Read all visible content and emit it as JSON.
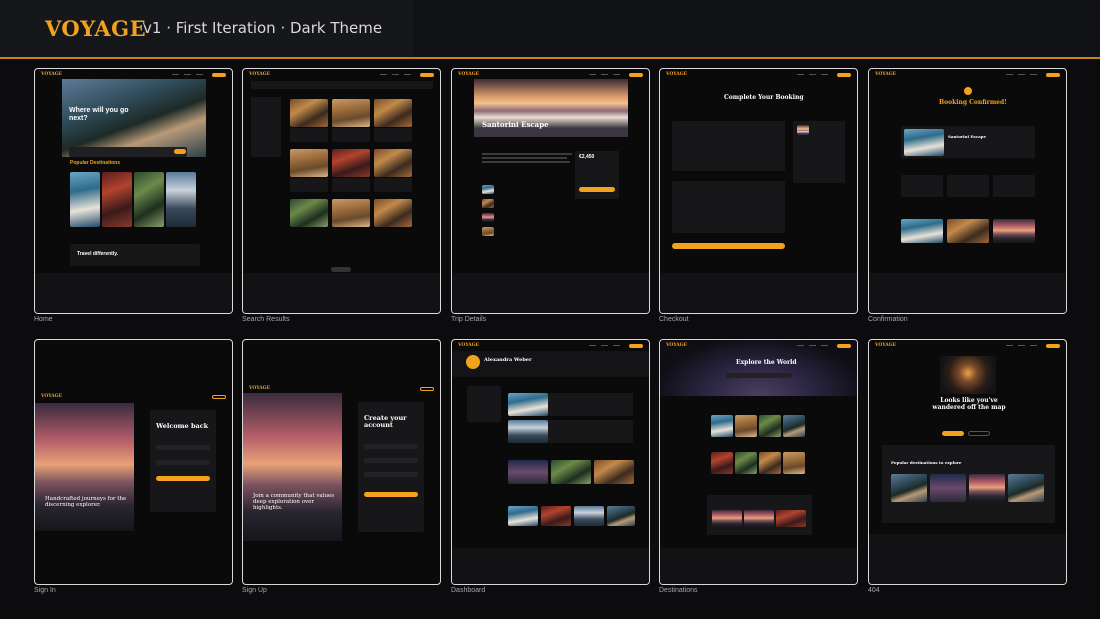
{
  "header": {
    "logo": "VOYAGE",
    "subtitle": "v1 · First Iteration · Dark Theme"
  },
  "colors": {
    "accent": "#f2a21c",
    "background": "#0c0c0e",
    "card_border": "#d9d9d9"
  },
  "screens": [
    {
      "label": "Home",
      "text": {
        "hero": "Where will you go next?",
        "section": "Popular Destinations",
        "banner": "Travel differently."
      }
    },
    {
      "label": "Search Results",
      "text": {}
    },
    {
      "label": "Trip Details",
      "text": {
        "title": "Santorini Escape",
        "price": "€2,450"
      }
    },
    {
      "label": "Checkout",
      "text": {
        "title": "Complete Your Booking"
      }
    },
    {
      "label": "Confirmation",
      "text": {
        "title": "Booking Confirmed!",
        "trip": "Santorini Escape"
      }
    },
    {
      "label": "Sign In",
      "text": {
        "title": "Welcome back",
        "tagline": "Handcrafted journeys for the discerning explorer."
      }
    },
    {
      "label": "Sign Up",
      "text": {
        "title": "Create your account",
        "tagline": "Join a community that values deep exploration over highlights."
      }
    },
    {
      "label": "Dashboard",
      "text": {
        "name": "Alexandra Weber"
      }
    },
    {
      "label": "Destinations",
      "text": {
        "title": "Explore the World"
      }
    },
    {
      "label": "404",
      "text": {
        "title": "Looks like you've wandered off the map",
        "section": "Popular destinations to explore"
      }
    }
  ],
  "icons": [
    "check-icon"
  ]
}
